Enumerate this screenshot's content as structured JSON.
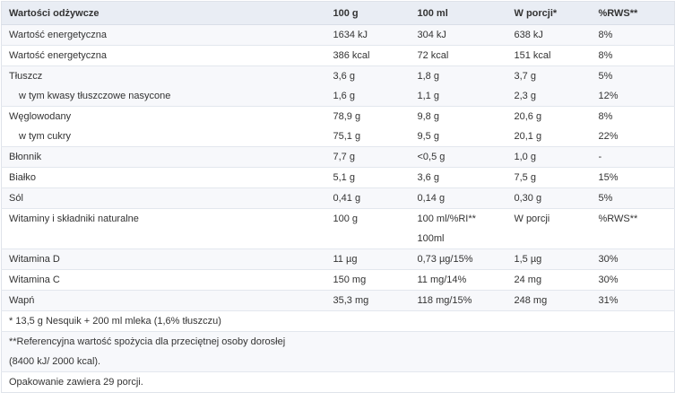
{
  "header": [
    "Wartości odżywcze",
    "100 g",
    "100 ml",
    "W porcji*",
    "%RWS**"
  ],
  "rows": [
    [
      "Wartość energetyczna",
      "1634 kJ",
      "304 kJ",
      "638 kJ",
      "8%"
    ],
    [
      "Wartość energetyczna",
      "386 kcal",
      "72 kcal",
      "151 kcal",
      "8%"
    ],
    [
      "Tłuszcz",
      "3,6 g",
      "1,8 g",
      "3,7 g",
      "5%"
    ],
    [
      "w tym kwasy tłuszczowe nasycone",
      "1,6 g",
      "1,1 g",
      "2,3 g",
      "12%"
    ],
    [
      "Węglowodany",
      "78,9 g",
      "9,8 g",
      "20,6 g",
      "8%"
    ],
    [
      "w tym cukry",
      "75,1 g",
      "9,5 g",
      "20,1 g",
      "22%"
    ],
    [
      "Błonnik",
      "7,7 g",
      "<0,5 g",
      "1,0 g",
      "-"
    ],
    [
      "Białko",
      "5,1 g",
      "3,6 g",
      "7,5 g",
      "15%"
    ],
    [
      "Sól",
      "0,41 g",
      "0,14 g",
      "0,30 g",
      "5%"
    ],
    [
      "Witaminy i składniki naturalne",
      "100 g",
      "100 ml/%RI**",
      "W porcji",
      "%RWS**"
    ],
    [
      "",
      "",
      "100ml",
      "",
      ""
    ],
    [
      "Witamina D",
      "11 µg",
      "0,73 µg/15%",
      "1,5 µg",
      "30%"
    ],
    [
      "Witamina C",
      "150 mg",
      "11 mg/14%",
      "24 mg",
      "30%"
    ],
    [
      "Wapń",
      "35,3 mg",
      "118 mg/15%",
      "248 mg",
      "31%"
    ]
  ],
  "footnotes": [
    "* 13,5 g Nesquik + 200 ml mleka (1,6% tłuszczu)",
    "**Referencyjna wartość spożycia dla przeciętnej osoby dorosłej",
    "(8400 kJ/ 2000 kcal).",
    "Opakowanie zawiera 29 porcji."
  ]
}
